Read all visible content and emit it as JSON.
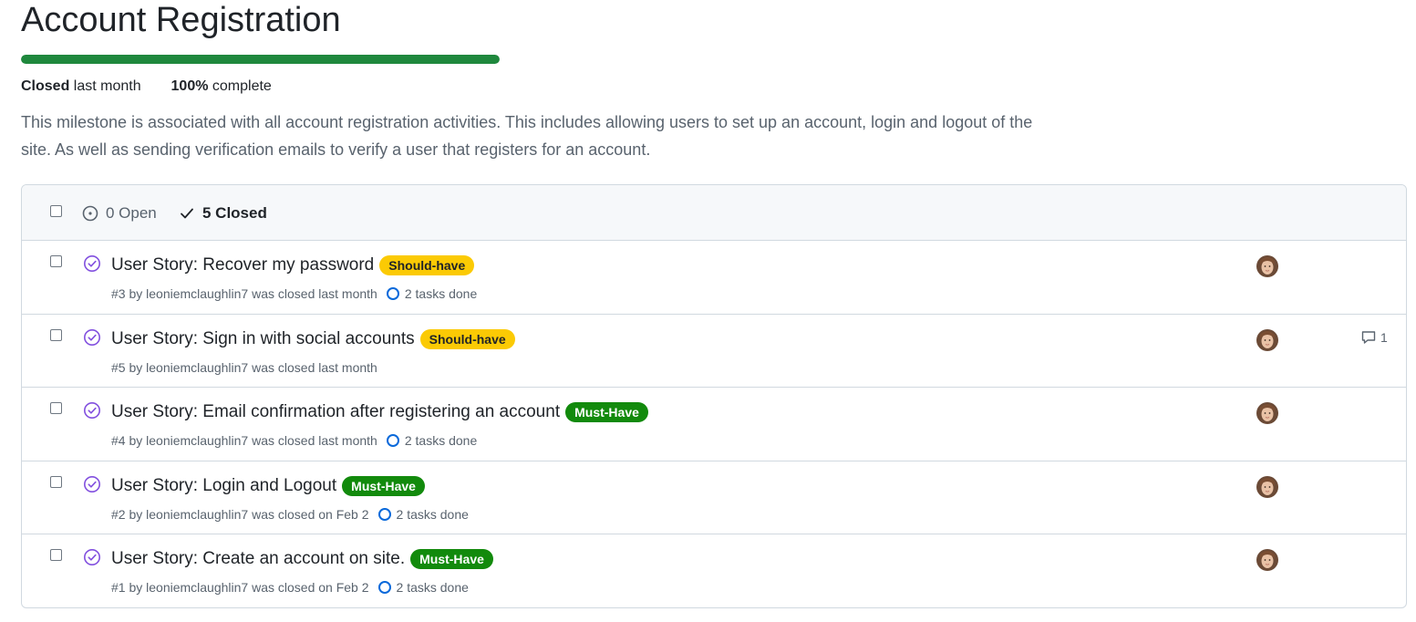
{
  "milestone": {
    "title": "Account Registration",
    "progress_percent": 100,
    "status_strong": "Closed",
    "status_rest": "last month",
    "complete_strong": "100%",
    "complete_rest": "complete",
    "description": "This milestone is associated with all account registration activities. This includes allowing users to set up an account, login and logout of the site. As well as sending verification emails to verify a user that registers for an account."
  },
  "colors": {
    "progress": "#1f883d",
    "should_have": "#fbca04",
    "must_have": "#128a0c",
    "closed_issue_icon": "#8250df",
    "task_ring": "#0969da"
  },
  "header": {
    "open_label": "0 Open",
    "closed_label": "5 Closed",
    "open_icon": "issue-opened-icon",
    "closed_icon": "check-icon"
  },
  "issues": [
    {
      "title": "User Story: Recover my password",
      "label": "Should-have",
      "label_type": "should",
      "meta": "#3 by leoniemclaughlin7 was closed last month",
      "tasks": "2 tasks done",
      "comments": ""
    },
    {
      "title": "User Story: Sign in with social accounts",
      "label": "Should-have",
      "label_type": "should",
      "meta": "#5 by leoniemclaughlin7 was closed last month",
      "tasks": "",
      "comments": "1"
    },
    {
      "title": "User Story: Email confirmation after registering an account",
      "label": "Must-Have",
      "label_type": "must",
      "meta": "#4 by leoniemclaughlin7 was closed last month",
      "tasks": "2 tasks done",
      "comments": ""
    },
    {
      "title": "User Story: Login and Logout",
      "label": "Must-Have",
      "label_type": "must",
      "meta": "#2 by leoniemclaughlin7 was closed on Feb 2",
      "tasks": "2 tasks done",
      "comments": ""
    },
    {
      "title": "User Story: Create an account on site.",
      "label": "Must-Have",
      "label_type": "must",
      "meta": "#1 by leoniemclaughlin7 was closed on Feb 2",
      "tasks": "2 tasks done",
      "comments": ""
    }
  ]
}
